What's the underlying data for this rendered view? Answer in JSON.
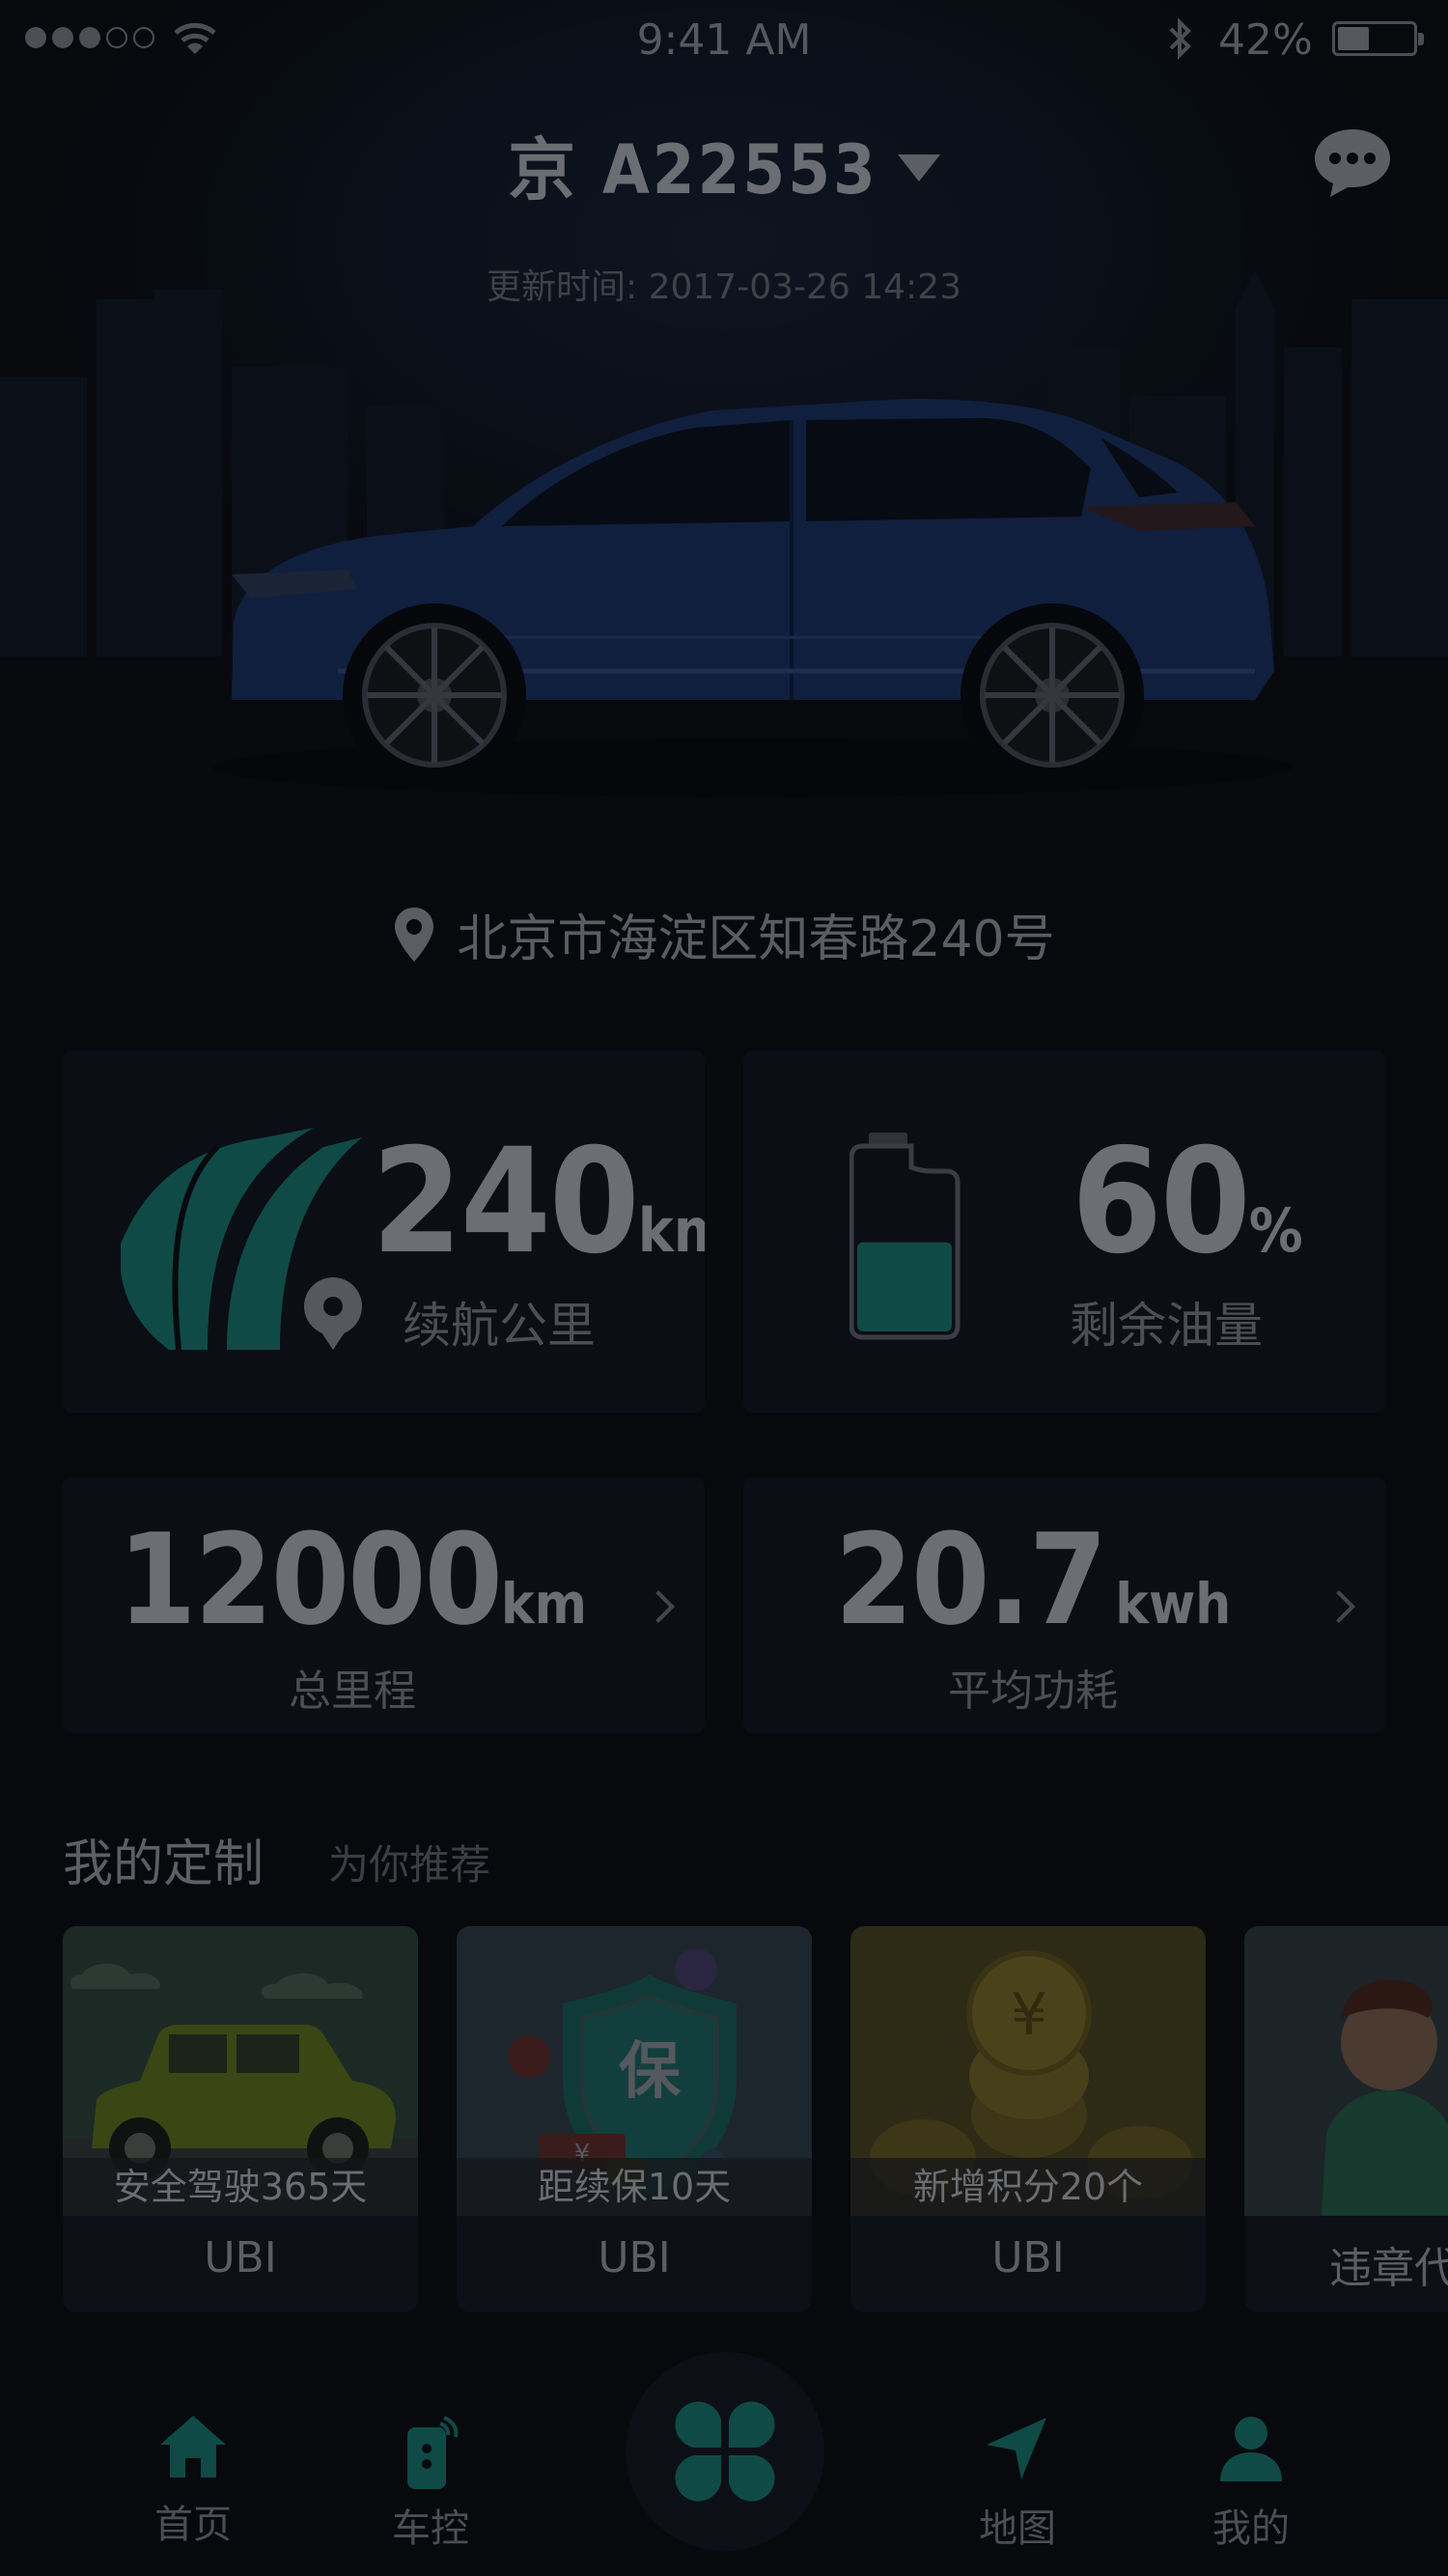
{
  "status_bar": {
    "time": "9:41 AM",
    "battery_percent_text": "42%",
    "battery_level": 0.42
  },
  "header": {
    "plate": "京 A22553",
    "update_label": "更新时间:",
    "update_time": "2017-03-26 14:23"
  },
  "location": {
    "address": "北京市海淀区知春路240号"
  },
  "stats": {
    "range": {
      "value": "240",
      "unit": "km",
      "label": "续航公里"
    },
    "fuel": {
      "value": "60",
      "unit": "%",
      "label": "剩余油量",
      "level": 0.6
    },
    "mileage": {
      "value": "12000",
      "unit": "km",
      "label": "总里程"
    },
    "consumption": {
      "value": "20.7",
      "unit": "kwh",
      "label": "平均功耗"
    }
  },
  "custom": {
    "title": "我的定制",
    "subtitle": "为你推荐",
    "tiles": [
      {
        "caption": "安全驾驶365天",
        "label": "UBI"
      },
      {
        "caption": "距续保10天",
        "label": "UBI",
        "badge": "保",
        "coupon": "¥"
      },
      {
        "caption": "新增积分20个",
        "label": "UBI",
        "coin": "¥"
      },
      {
        "caption": "",
        "label": "违章代"
      }
    ]
  },
  "tabbar": {
    "home": "首页",
    "control": "车控",
    "map": "地图",
    "mine": "我的"
  },
  "colors": {
    "accent": "#0f4a46",
    "accent_bright": "#1a6b66",
    "background": "#07090d"
  },
  "icons": [
    "wifi-icon",
    "bluetooth-icon",
    "message-icon",
    "location-pin-icon",
    "road-icon",
    "fuel-bottle-icon",
    "home-icon",
    "car-key-icon",
    "clover-icon",
    "navigate-icon",
    "user-icon"
  ]
}
